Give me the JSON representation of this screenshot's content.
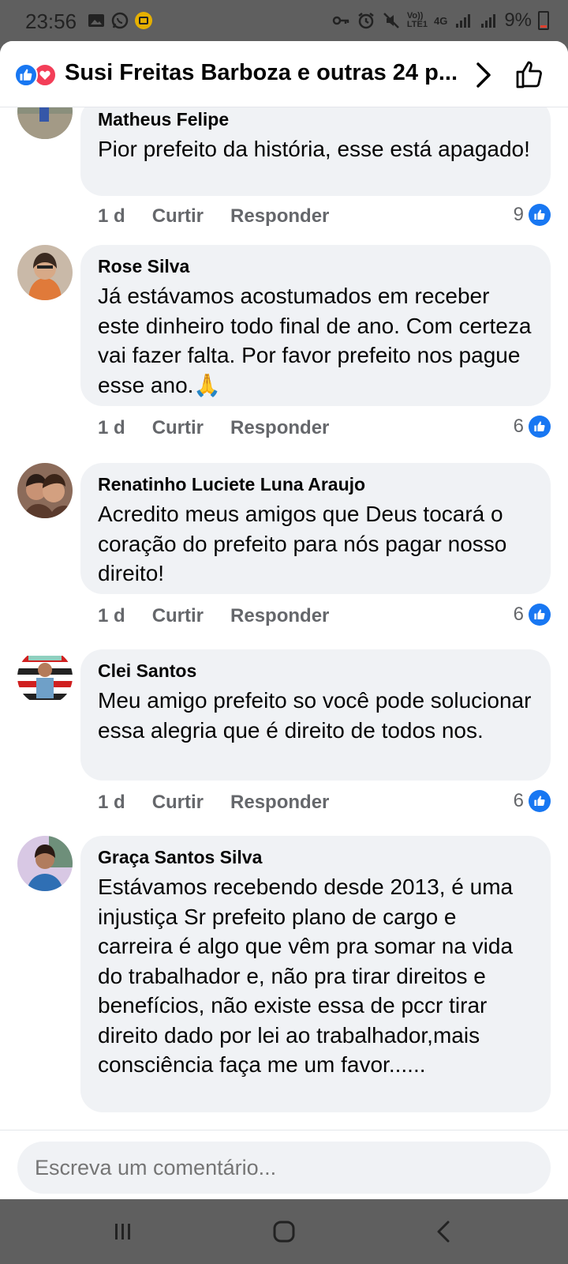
{
  "status_bar": {
    "time": "23:56",
    "battery": "9%",
    "net_label_top": "Vo))",
    "net_label_bottom": "LTE1",
    "net_type": "4G"
  },
  "header": {
    "title": "Susi Freitas Barboza e outras 24 p...",
    "reactions": [
      "like-icon",
      "love-icon"
    ]
  },
  "comments": [
    {
      "author": "Matheus Felipe",
      "text": "Pior prefeito da história, esse está apagado!",
      "time": "1 d",
      "like_label": "Curtir",
      "reply_label": "Responder",
      "likes": "9"
    },
    {
      "author": "Rose Silva",
      "text": "Já estávamos acostumados em receber este dinheiro todo final de ano. Com certeza vai fazer falta. Por favor prefeito nos pague esse ano.🙏",
      "time": "1 d",
      "like_label": "Curtir",
      "reply_label": "Responder",
      "likes": "6"
    },
    {
      "author": "Renatinho Luciete Luna Araujo",
      "text": "Acredito meus amigos que Deus tocará o coração do prefeito para nós pagar nosso direito!",
      "time": "1 d",
      "like_label": "Curtir",
      "reply_label": "Responder",
      "likes": "6"
    },
    {
      "author": "Clei Santos",
      "text": "Meu amigo prefeito so você pode solucionar essa alegria que é direito de todos nos.",
      "time": "1 d",
      "like_label": "Curtir",
      "reply_label": "Responder",
      "likes": "6"
    },
    {
      "author": "Graça Santos Silva",
      "text": "Estávamos recebendo desde 2013, é uma injustiça Sr prefeito plano de cargo e carreira é algo que vêm pra somar na vida do trabalhador e, não pra tirar direitos e benefícios, não existe essa de pccr tirar direito dado por lei ao trabalhador,mais consciência faça me um favor......"
    }
  ],
  "composer": {
    "placeholder": "Escreva um comentário..."
  },
  "colors": {
    "like_blue": "#1877f2",
    "love_red": "#f33e58",
    "bubble_bg": "#f0f2f5",
    "meta_gray": "#65676b"
  }
}
